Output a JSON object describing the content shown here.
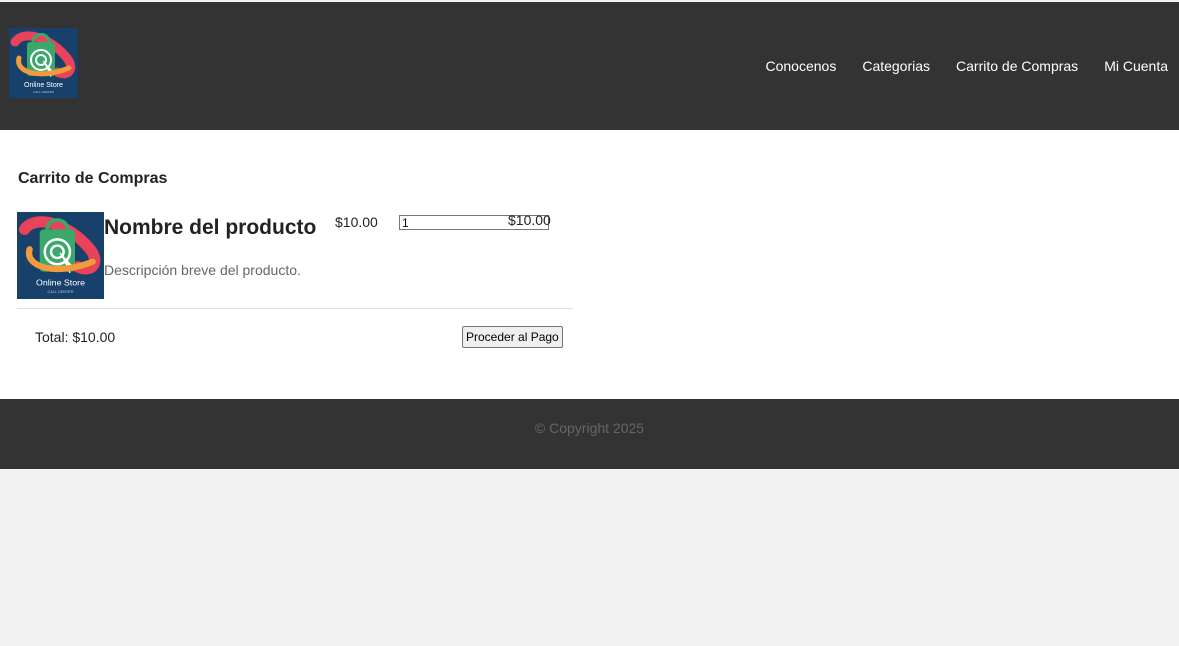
{
  "header": {
    "logo": {
      "text": "Online Store",
      "subtext": "CALL CENTER"
    },
    "nav": [
      "Conocenos",
      "Categorias",
      "Carrito de Compras",
      "Mi Cuenta"
    ]
  },
  "cart": {
    "title": "Carrito de Compras",
    "items": [
      {
        "name": "Nombre del producto",
        "description": "Descripción breve del producto.",
        "price": "$10.00",
        "quantity": "1",
        "subtotal": "$10.00",
        "image_text": "Online Store",
        "image_subtext": "CALL CENTER"
      }
    ],
    "total": "Total: $10.00",
    "checkout_label": "Proceder al Pago"
  },
  "footer": {
    "copyright": "© Copyright 2025"
  },
  "colors": {
    "header_bg": "#333333",
    "footer_bg": "#333333",
    "page_bg": "#f2f2f2",
    "content_bg": "#ffffff"
  }
}
